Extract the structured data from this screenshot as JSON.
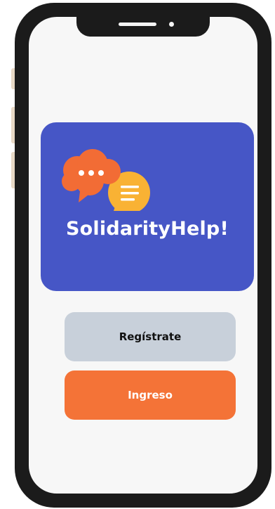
{
  "app": {
    "title": "SolidarityHelp!"
  },
  "buttons": {
    "register_label": "Regístrate",
    "login_label": "Ingreso"
  },
  "icons": {
    "logo": "chat-bubbles-icon"
  },
  "colors": {
    "hero_background": "#4656c6",
    "register_button": "#c8d0da",
    "login_button": "#f47337",
    "bubble_orange": "#f26c35",
    "bubble_yellow": "#f9b234",
    "screen_background": "#f7f7f7"
  }
}
